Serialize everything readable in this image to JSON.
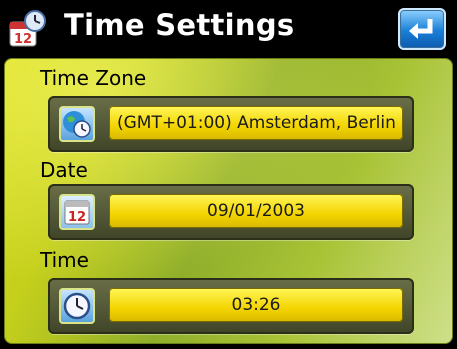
{
  "header": {
    "title": "Time Settings",
    "title_icon": "calendar-clock-icon",
    "back_icon": "enter-return-icon"
  },
  "sections": {
    "timezone": {
      "label": "Time Zone",
      "value": "(GMT+01:00) Amsterdam, Berlin",
      "icon": "globe-clock-icon"
    },
    "date": {
      "label": "Date",
      "value": "09/01/2003",
      "icon": "calendar-icon",
      "icon_text": "12"
    },
    "time": {
      "label": "Time",
      "value": "03:26",
      "icon": "clock-icon"
    }
  },
  "colors": {
    "panel_accent": "#c4cf1c",
    "field": "#f3d400",
    "back_button": "#1a7fd6"
  }
}
